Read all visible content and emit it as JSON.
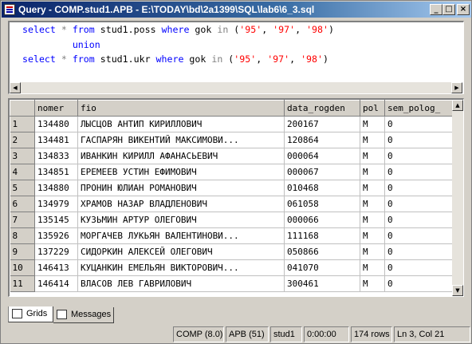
{
  "window": {
    "title": "Query - COMP.stud1.АРВ - E:\\TODAY\\bd\\2a1399\\SQL\\lab6\\6_3.sql",
    "controls": {
      "minimize": "_",
      "maximize": "□",
      "close": "×"
    }
  },
  "editor": {
    "lines": [
      [
        {
          "t": "select",
          "c": "kw"
        },
        {
          "t": " "
        },
        {
          "t": "*",
          "c": "op"
        },
        {
          "t": " "
        },
        {
          "t": "from",
          "c": "kw"
        },
        {
          "t": " stud1.poss "
        },
        {
          "t": "where",
          "c": "kw"
        },
        {
          "t": " gok "
        },
        {
          "t": "in",
          "c": "op"
        },
        {
          "t": " ("
        },
        {
          "t": "'95'",
          "c": "str"
        },
        {
          "t": ", "
        },
        {
          "t": "'97'",
          "c": "str"
        },
        {
          "t": ", "
        },
        {
          "t": "'98'",
          "c": "str"
        },
        {
          "t": ")"
        }
      ],
      [
        {
          "t": "         "
        },
        {
          "t": "union",
          "c": "kw"
        }
      ],
      [
        {
          "t": "select",
          "c": "kw"
        },
        {
          "t": " "
        },
        {
          "t": "*",
          "c": "op"
        },
        {
          "t": " "
        },
        {
          "t": "from",
          "c": "kw"
        },
        {
          "t": " stud1.ukr "
        },
        {
          "t": "where",
          "c": "kw"
        },
        {
          "t": " gok "
        },
        {
          "t": "in",
          "c": "op"
        },
        {
          "t": " ("
        },
        {
          "t": "'95'",
          "c": "str"
        },
        {
          "t": ", "
        },
        {
          "t": "'97'",
          "c": "str"
        },
        {
          "t": ", "
        },
        {
          "t": "'98'",
          "c": "str"
        },
        {
          "t": ")"
        }
      ]
    ]
  },
  "grid": {
    "columns": [
      "",
      "nomer",
      "fio",
      "data_rogden",
      "pol",
      "sem_polog_"
    ],
    "rows": [
      [
        "1",
        "134480",
        "ЛЫСЦОВ АНТИП КИРИЛЛОВИЧ",
        "200167",
        "М",
        "0"
      ],
      [
        "2",
        "134481",
        "ГАСПАРЯН ВИКЕНТИЙ МАКСИМОВИ...",
        "120864",
        "М",
        "0"
      ],
      [
        "3",
        "134833",
        "ИВАНКИН КИРИЛЛ АФАНАСЬЕВИЧ",
        "000064",
        "М",
        "0"
      ],
      [
        "4",
        "134851",
        "ЕРЕМЕЕВ УСТИН ЕФИМОВИЧ",
        "000067",
        "М",
        "0"
      ],
      [
        "5",
        "134880",
        "ПРОНИН ЮЛИАН РОМАНОВИЧ",
        "010468",
        "М",
        "0"
      ],
      [
        "6",
        "134979",
        "ХРАМОВ НАЗАР ВЛАДЛЕНОВИЧ",
        "061058",
        "М",
        "0"
      ],
      [
        "7",
        "135145",
        "КУЗЬМИН АРТУР ОЛЕГОВИЧ",
        "000066",
        "М",
        "0"
      ],
      [
        "8",
        "135926",
        "МОРГАЧЕВ ЛУКЬЯН ВАЛЕНТИНОВИ...",
        "111168",
        "М",
        "0"
      ],
      [
        "9",
        "137229",
        "СИДОРКИН АЛЕКСЕЙ ОЛЕГОВИЧ",
        "050866",
        "М",
        "0"
      ],
      [
        "10",
        "146413",
        "КУЦАНКИН ЕМЕЛЬЯН ВИКТОРОВИЧ...",
        "041070",
        "М",
        "0"
      ],
      [
        "11",
        "146414",
        "ВЛАСОВ ЛЕВ ГАВРИЛОВИЧ",
        "300461",
        "М",
        "0"
      ]
    ]
  },
  "tabs": [
    {
      "label": "Grids",
      "icon": "grid-icon",
      "active": true
    },
    {
      "label": "Messages",
      "icon": "messages-icon",
      "active": false
    }
  ],
  "status": {
    "connection": "COMP (8.0)",
    "user": "АРВ (51)",
    "database": "stud1",
    "time": "0:00:00",
    "rows": "174 rows",
    "position": "Ln 3, Col 21"
  }
}
